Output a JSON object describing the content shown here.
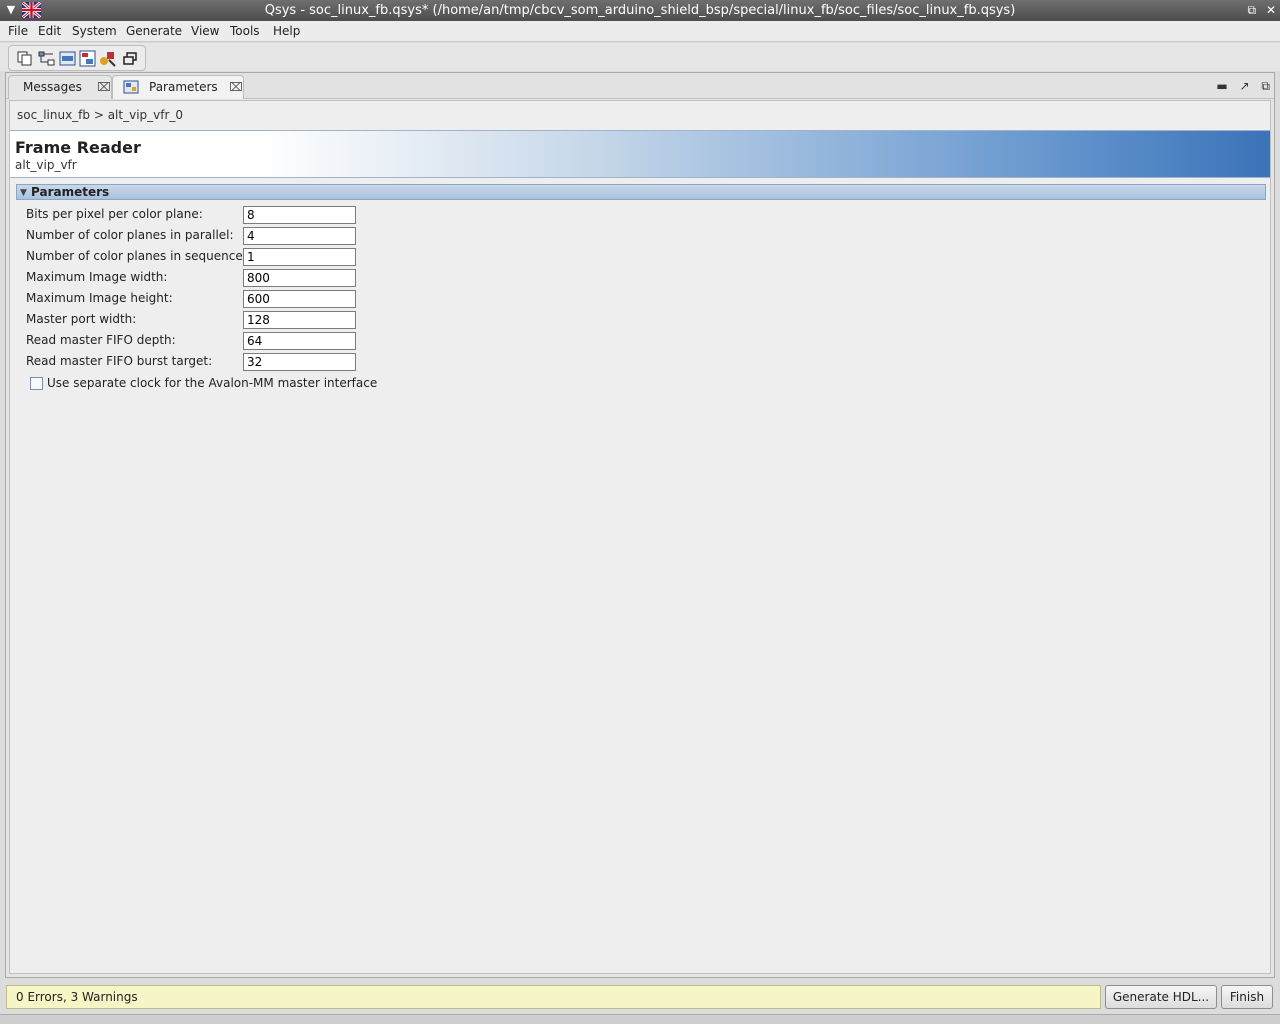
{
  "window": {
    "title": "Qsys - soc_linux_fb.qsys* (/home/an/tmp/cbcv_som_arduino_shield_bsp/special/linux_fb/soc_files/soc_linux_fb.qsys)"
  },
  "menubar": {
    "items": [
      {
        "label": "File"
      },
      {
        "label": "Edit"
      },
      {
        "label": "System"
      },
      {
        "label": "Generate"
      },
      {
        "label": "View"
      },
      {
        "label": "Tools"
      },
      {
        "label": "Help"
      }
    ]
  },
  "toolbar": {
    "icons": [
      "copy-icon",
      "schematic-icon",
      "hdl-icon",
      "hierarchy-icon",
      "palette-icon",
      "restore-window-icon"
    ]
  },
  "tabs": [
    {
      "label": "Messages",
      "active": false
    },
    {
      "label": "Parameters",
      "active": true
    }
  ],
  "breadcrumb": "soc_linux_fb  >  alt_vip_vfr_0",
  "header": {
    "title": "Frame Reader",
    "subtitle": "alt_vip_vfr"
  },
  "section": {
    "label": "Parameters"
  },
  "parameters": [
    {
      "label": "Bits per pixel per color plane:",
      "value": "8"
    },
    {
      "label": "Number of color planes in parallel:",
      "value": "4"
    },
    {
      "label": "Number of color planes in sequence:",
      "value": "1"
    },
    {
      "label": "Maximum Image width:",
      "value": "800"
    },
    {
      "label": "Maximum Image height:",
      "value": "600"
    },
    {
      "label": "Master port width:",
      "value": "128"
    },
    {
      "label": "Read master FIFO depth:",
      "value": "64"
    },
    {
      "label": "Read master FIFO burst target:",
      "value": "32"
    }
  ],
  "separate_clock": {
    "label": "Use separate clock for the Avalon-MM master interface",
    "checked": false
  },
  "status": {
    "text": "0 Errors, 3 Warnings"
  },
  "buttons": {
    "generate_hdl": "Generate HDL...",
    "finish": "Finish"
  },
  "colors": {
    "header_gradient_end": "#3b73b9",
    "status_background": "#f5f5c6"
  }
}
